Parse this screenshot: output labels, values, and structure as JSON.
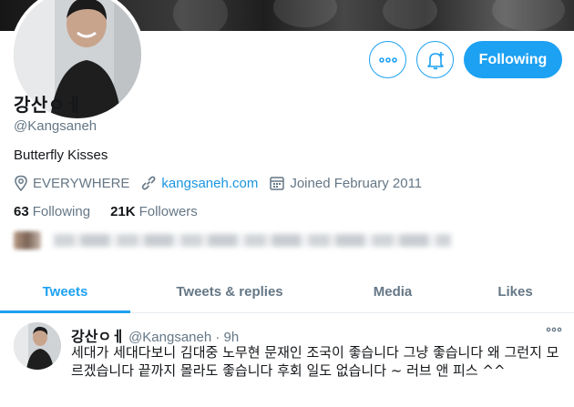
{
  "profile": {
    "name": "강산ㅇㅔ",
    "handle": "@Kangsaneh",
    "bio": "Butterfly Kisses",
    "location": "EVERYWHERE",
    "website": "kangsaneh.com",
    "joined": "Joined February 2011",
    "following_count": "63",
    "following_label": "Following",
    "followers_count": "21K",
    "followers_label": "Followers"
  },
  "actions": {
    "more_icon": "more-dots-icon",
    "notify_icon": "bell-plus-icon",
    "follow_label": "Following"
  },
  "tabs": [
    {
      "label": "Tweets",
      "active": true
    },
    {
      "label": "Tweets & replies",
      "active": false
    },
    {
      "label": "Media",
      "active": false
    },
    {
      "label": "Likes",
      "active": false
    }
  ],
  "tweet": {
    "name": "강산ㅇㅔ",
    "handle": "@Kangsaneh",
    "dot": "·",
    "time": "9h",
    "text": "세대가 세대다보니 김대중 노무현 문재인 조국이 좋습니다 그냥 좋습니다 왜 그런지 모르겠습니다 끝까지 몰라도 좋습니다 후회 일도 없습니다 ~   러브 앤 피스     ^^"
  },
  "colors": {
    "accent": "#1da1f2",
    "link": "#1b95e0",
    "secondary_text": "#657786",
    "primary_text": "#14171a",
    "border": "#e6ecf0"
  }
}
